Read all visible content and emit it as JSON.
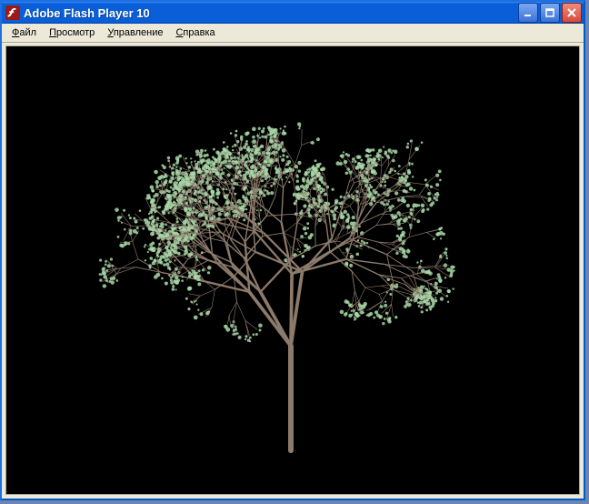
{
  "window": {
    "title": "Adobe Flash Player 10"
  },
  "menubar": {
    "items": [
      {
        "label": "Файл",
        "accel": 0
      },
      {
        "label": "Просмотр",
        "accel": 0
      },
      {
        "label": "Управление",
        "accel": 0
      },
      {
        "label": "Справка",
        "accel": 0
      }
    ]
  },
  "icons": {
    "app": "flash-icon",
    "minimize": "minimize-icon",
    "maximize": "maximize-icon",
    "close": "close-icon"
  },
  "scene": {
    "background": "#000000",
    "tree": {
      "trunk_color": "#8c7a6b",
      "leaf_color": "#a8d8a8",
      "trunk_base": [
        322,
        498
      ],
      "depth": 6,
      "spread": 42,
      "shrink": 0.72,
      "initial_length": 115
    }
  }
}
